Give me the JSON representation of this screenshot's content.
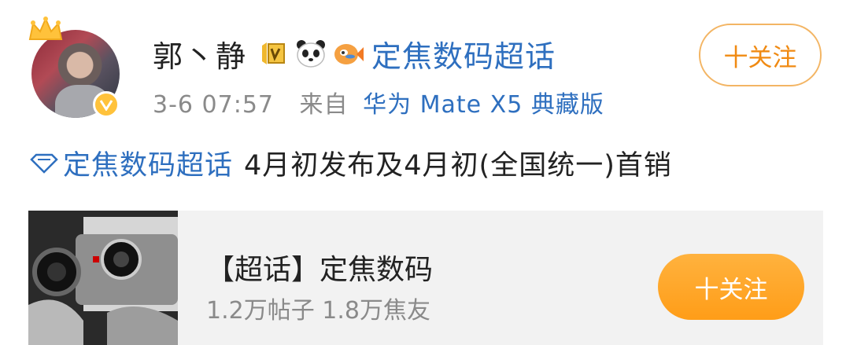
{
  "user": {
    "name": "郭丶静",
    "topic": "定焦数码超话"
  },
  "meta": {
    "date": "3-6 07:57",
    "from": "来自",
    "device": "华为 Mate X5 典藏版"
  },
  "follow_top": "十关注",
  "post": {
    "tag": "定焦数码超话",
    "body": "4月初发布及4月初(全国统一)首销"
  },
  "card": {
    "title": "【超话】定焦数码",
    "stats": "1.2万帖子 1.8万焦友",
    "follow": "十关注"
  },
  "colors": {
    "link": "#2e6fbf",
    "accent": "#ff9d18",
    "badge": "#ffc23b"
  },
  "icons": [
    "crown-icon",
    "verified-badge-icon",
    "level-badge-icon",
    "panda-icon",
    "pufferfish-icon",
    "topic-diamond-icon"
  ]
}
